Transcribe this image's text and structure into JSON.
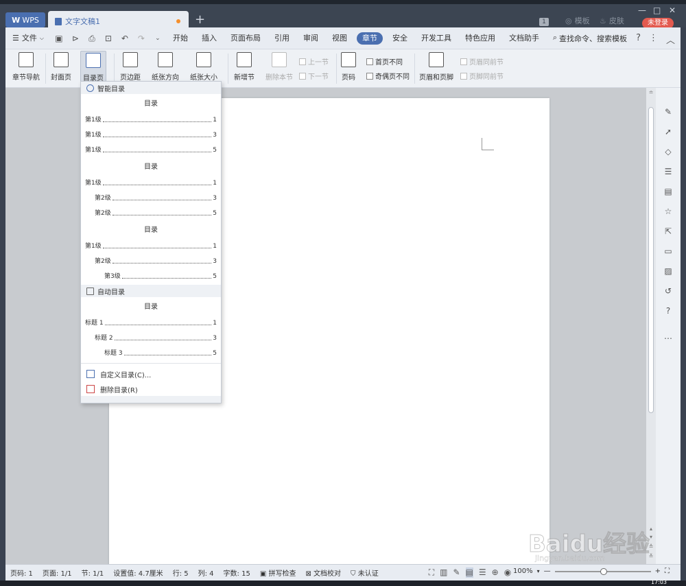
{
  "titlebar": {
    "wps_tab": "WPS",
    "doc_tab": "文字文稿1",
    "new_tab": "+",
    "badge": "1",
    "template_label": "模板",
    "skin_label": "皮肤",
    "login_label": "未登录"
  },
  "menubar": {
    "file_label": "文件",
    "items": [
      "开始",
      "插入",
      "页面布局",
      "引用",
      "审阅",
      "视图",
      "章节",
      "安全",
      "开发工具",
      "特色应用",
      "文档助手"
    ],
    "active_item": "章节",
    "search_label": "查找命令、搜索模板",
    "help": "?"
  },
  "ribbon": {
    "buttons": [
      {
        "label": "章节导航"
      },
      {
        "label": "封面页"
      },
      {
        "label": "目录页"
      },
      {
        "label": "页边距"
      },
      {
        "label": "纸张方向"
      },
      {
        "label": "纸张大小"
      },
      {
        "label": "新增节"
      },
      {
        "label": "删除本节"
      },
      {
        "label": "页码"
      },
      {
        "label": "页眉和页脚"
      }
    ],
    "prev_section": "上一节",
    "next_section": "下一节",
    "first_page_diff": "首页不同",
    "odd_even_diff": "奇偶页不同",
    "header_same_prev": "页眉同前节",
    "footer_same_prev": "页脚同前节"
  },
  "dropdown": {
    "smart_header": "智能目录",
    "auto_header": "自动目录",
    "toc_title": "目录",
    "blocks": [
      {
        "lines": [
          {
            "label": "第1级",
            "page": "1",
            "level": 1
          },
          {
            "label": "第1级",
            "page": "3",
            "level": 1
          },
          {
            "label": "第1级",
            "page": "5",
            "level": 1
          }
        ]
      },
      {
        "lines": [
          {
            "label": "第1级",
            "page": "1",
            "level": 1
          },
          {
            "label": "第2级",
            "page": "3",
            "level": 2
          },
          {
            "label": "第2级",
            "page": "5",
            "level": 2
          }
        ]
      },
      {
        "lines": [
          {
            "label": "第1级",
            "page": "1",
            "level": 1
          },
          {
            "label": "第2级",
            "page": "3",
            "level": 2
          },
          {
            "label": "第3级",
            "page": "5",
            "level": 3
          }
        ]
      }
    ],
    "auto_lines": [
      {
        "label": "标题 1",
        "page": "1",
        "level": 1
      },
      {
        "label": "标题 2",
        "page": "3",
        "level": 2
      },
      {
        "label": "标题 3",
        "page": "5",
        "level": 3
      }
    ],
    "custom_toc": "自定义目录(C)...",
    "delete_toc": "删除目录(R)"
  },
  "statusbar": {
    "page_num": "页码: 1",
    "pages": "页面: 1/1",
    "section": "节: 1/1",
    "setting": "设置值: 4.7厘米",
    "row": "行: 5",
    "col": "列: 4",
    "word_count": "字数: 15",
    "spell_check": "拼写检查",
    "proofread": "文档校对",
    "uncertified": "未认证",
    "zoom": "100%",
    "clock": "17:03"
  },
  "watermark": {
    "text": "Baidu经验",
    "sub": "jingyan.baidu.com"
  },
  "colors": {
    "accent": "#4a6fb0",
    "titlebar": "#3c4552",
    "login": "#e35a4f",
    "workspace": "#c8cbcf"
  }
}
